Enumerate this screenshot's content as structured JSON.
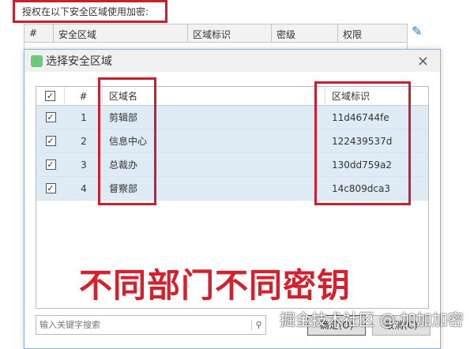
{
  "top_label": "授权在以下安全区域使用加密:",
  "bg_table": {
    "headers": [
      "#",
      "安全区域",
      "区域标识",
      "密级",
      "权限"
    ]
  },
  "dialog": {
    "title": "选择安全区域",
    "close": "×",
    "headers": [
      "#",
      "区域名",
      "区域标识"
    ],
    "rows": [
      {
        "num": "1",
        "name": "剪辑部",
        "id": "11d46744fe",
        "checked": true
      },
      {
        "num": "2",
        "name": "信息中心",
        "id": "122439537d",
        "checked": true
      },
      {
        "num": "3",
        "name": "总裁办",
        "id": "130dd759a2",
        "checked": true
      },
      {
        "num": "4",
        "name": "督察部",
        "id": "14c809dca3",
        "checked": true
      }
    ],
    "search_placeholder": "输入关键字搜索",
    "ok": "确定(O)",
    "cancel": "取消(C)"
  },
  "overlay_caption": "不同部门不同密钥",
  "watermark": "掘金技术社区 @ 加加加密",
  "colors": {
    "highlight": "#c8202c",
    "row": "#deebf5",
    "edit": "#1f73b7"
  }
}
